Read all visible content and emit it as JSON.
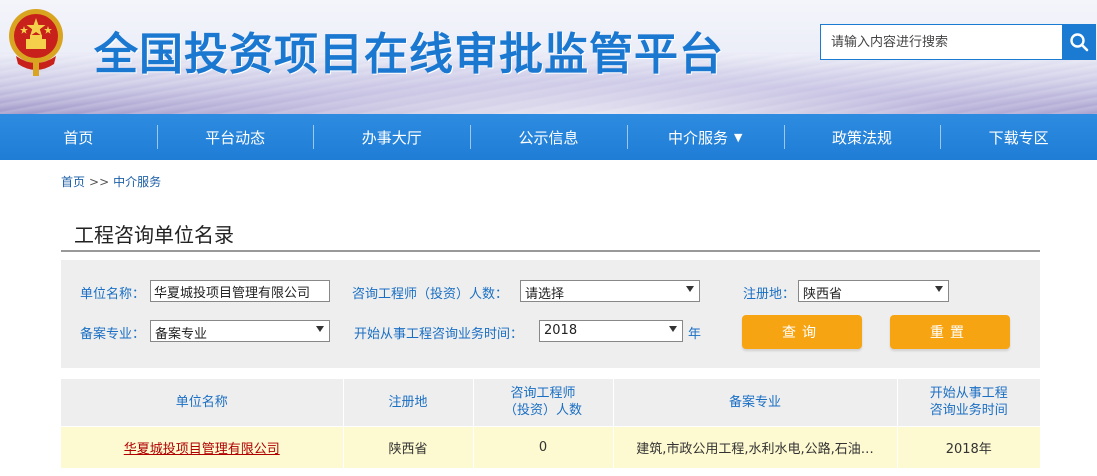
{
  "header": {
    "site_title": "全国投资项目在线审批监管平台",
    "search": {
      "placeholder": "请输入内容进行搜索",
      "value": ""
    },
    "search_icon": "search-icon",
    "emblem_icon": "national-emblem-icon"
  },
  "nav": {
    "items": [
      {
        "label": "首页"
      },
      {
        "label": "平台动态"
      },
      {
        "label": "办事大厅"
      },
      {
        "label": "公示信息"
      },
      {
        "label": "中介服务",
        "caret": "▼"
      },
      {
        "label": "政策法规"
      },
      {
        "label": "下载专区"
      }
    ]
  },
  "breadcrumb": {
    "home": "首页",
    "sep": ">>",
    "current": "中介服务"
  },
  "section": {
    "title": "工程咨询单位名录"
  },
  "filters": {
    "unit_name_label": "单位名称：",
    "unit_name_value": "华夏城投项目管理有限公司",
    "engineer_count_label": "咨询工程师（投资）人数：",
    "engineer_count_value": "请选择",
    "region_label": "注册地：",
    "region_value": "陕西省",
    "specialty_label": "备案专业：",
    "specialty_value": "备案专业",
    "start_year_label": "开始从事工程咨询业务时间：",
    "start_year_value": "2018",
    "year_suffix": "年",
    "query_button": "查询",
    "reset_button": "重置"
  },
  "table": {
    "headers": {
      "name": "单位名称",
      "region": "注册地",
      "engineers_line1": "咨询工程师",
      "engineers_line2": "（投资）人数",
      "specialty": "备案专业",
      "start_line1": "开始从事工程",
      "start_line2": "咨询业务时间"
    },
    "rows": [
      {
        "name": "华夏城投项目管理有限公司",
        "region": "陕西省",
        "engineers": "0",
        "specialty": "建筑,市政公用工程,水利水电,公路,石油…",
        "start": "2018年"
      }
    ]
  },
  "colors": {
    "nav_blue": "#1f7dd6",
    "title_blue": "#1b78d0",
    "label_blue": "#1a6fc4",
    "button_orange": "#f7a412",
    "row_highlight": "#fdf9d0",
    "link_red": "#b00000"
  }
}
